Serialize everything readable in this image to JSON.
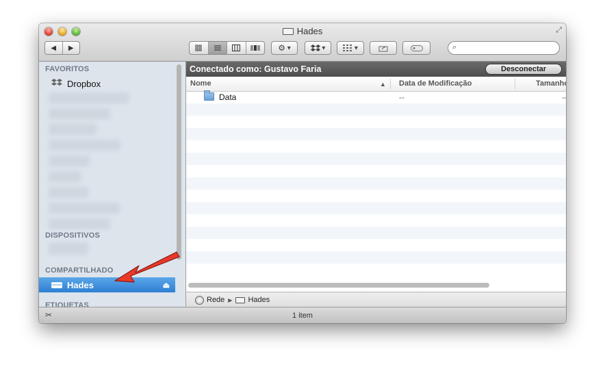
{
  "window": {
    "title": "Hades"
  },
  "icons": {
    "back": "◀",
    "forward": "▶",
    "action": "⚙",
    "dropdown": "▾",
    "search": "⌕",
    "eject": "⏏",
    "fullscreen": "⤢",
    "pin": "✂"
  },
  "sidebar": {
    "favorites_header": "FAVORITOS",
    "dropbox_label": "Dropbox",
    "devices_header": "DISPOSITIVOS",
    "shared_header": "COMPARTILHADO",
    "hades_label": "Hades",
    "tags_header": "ETIQUETAS"
  },
  "main": {
    "connected_as": "Conectado como: Gustavo Faria",
    "disconnect_label": "Desconectar",
    "columns": {
      "name": "Nome",
      "date": "Data de Modificação",
      "size": "Tamanho"
    },
    "sort_indicator": "▲",
    "rows": [
      {
        "name": "Data",
        "date": "--",
        "size": "--"
      }
    ]
  },
  "pathbar": {
    "network": "Rede",
    "server": "Hades"
  },
  "status": {
    "item_count": "1 item"
  },
  "colors": {
    "selection": "#2f7fd3",
    "annotation_arrow": "#e8392b"
  }
}
